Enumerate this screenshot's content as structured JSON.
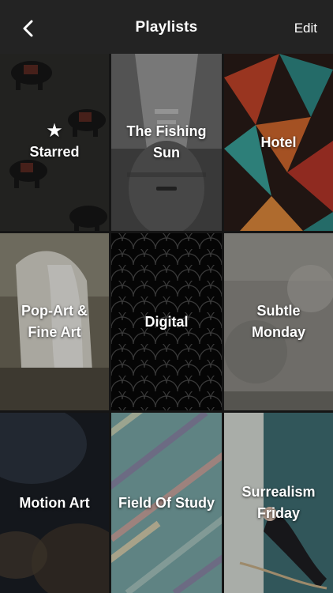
{
  "header": {
    "title": "Playlists",
    "edit_label": "Edit"
  },
  "playlists": [
    {
      "label": "Starred",
      "icon": "star-icon"
    },
    {
      "label": "The Fishing Sun"
    },
    {
      "label": "Hotel"
    },
    {
      "label": "Pop-Art & Fine Art"
    },
    {
      "label": "Digital"
    },
    {
      "label": "Subtle Monday"
    },
    {
      "label": "Motion Art"
    },
    {
      "label": "Field Of Study"
    },
    {
      "label": "Surrealism Friday"
    }
  ],
  "colors": {
    "header_bg": "#232323",
    "grid_gap": "#151515"
  }
}
